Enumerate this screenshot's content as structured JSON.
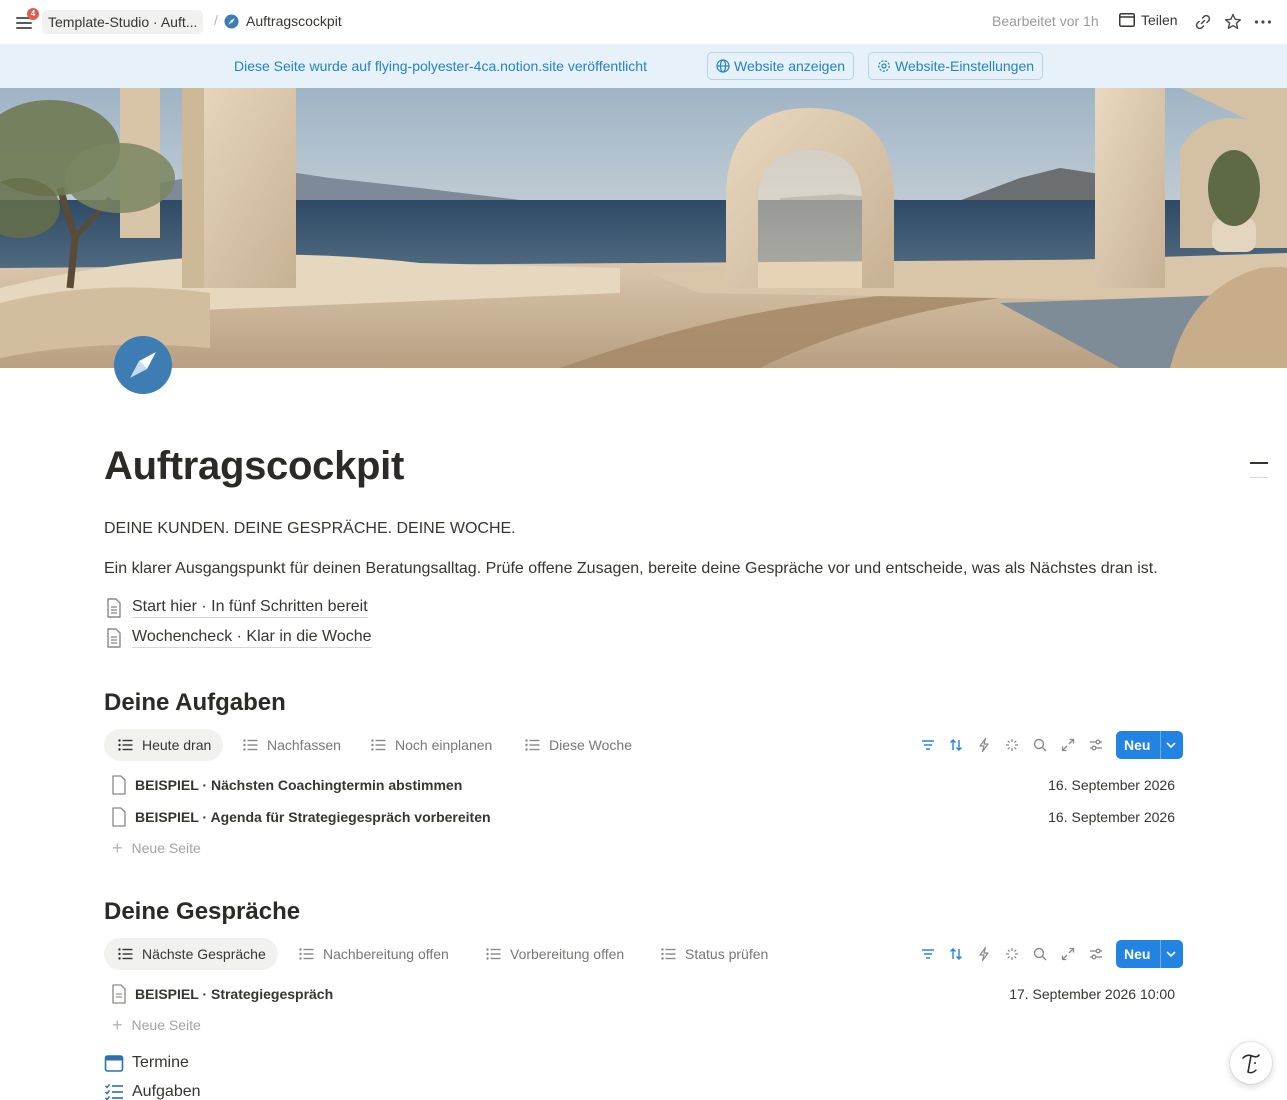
{
  "topbar": {
    "notification_count": "4",
    "breadcrumb_parent": "Template-Studio · Auft...",
    "breadcrumb_separator": "/",
    "breadcrumb_current": "Auftragscockpit",
    "edited": "Bearbeitet vor 1h",
    "share_label": "Teilen"
  },
  "banner": {
    "text": "Diese Seite wurde auf flying-polyester-4ca.notion.site veröffentlicht",
    "view_site": "Website anzeigen",
    "site_settings": "Website-Einstellungen"
  },
  "page": {
    "title": "Auftragscockpit",
    "tagline": "DEINE KUNDEN. DEINE GESPRÄCHE. DEINE WOCHE.",
    "intro": "Ein klarer Ausgangspunkt für deinen Beratungsalltag. Prüfe offene Zusagen, bereite deine Gespräche vor und entscheide, was als Nächstes dran ist.",
    "links": [
      {
        "label": "Start hier · In fünf Schritten bereit"
      },
      {
        "label": "Wochencheck · Klar in die Woche"
      }
    ]
  },
  "tasks": {
    "heading": "Deine Aufgaben",
    "tabs": [
      {
        "label": "Heute dran"
      },
      {
        "label": "Nachfassen"
      },
      {
        "label": "Noch einplanen"
      },
      {
        "label": "Diese Woche"
      }
    ],
    "new_label": "Neu",
    "rows": [
      {
        "name": "BEISPIEL · Nächsten Coachingtermin abstimmen",
        "date": "16. September 2026"
      },
      {
        "name": "BEISPIEL · Agenda für Strategiegespräch vorbereiten",
        "date": "16. September 2026"
      }
    ],
    "new_page": "Neue Seite"
  },
  "conversations": {
    "heading": "Deine Gespräche",
    "tabs": [
      {
        "label": "Nächste Gespräche"
      },
      {
        "label": "Nachbereitung offen"
      },
      {
        "label": "Vorbereitung offen"
      },
      {
        "label": "Status prüfen"
      }
    ],
    "new_label": "Neu",
    "rows": [
      {
        "name": "BEISPIEL · Strategiegespräch",
        "date": "17. September 2026 10:00"
      }
    ],
    "new_page": "Neue Seite"
  },
  "nav": [
    {
      "label": "Termine",
      "icon": "calendar-icon"
    },
    {
      "label": "Aufgaben",
      "icon": "checklist-icon"
    }
  ],
  "colors": {
    "accent": "#2383e2",
    "banner_bg": "#e6f1fa",
    "banner_text": "#2383c5",
    "page_icon": "#3d7db3"
  }
}
